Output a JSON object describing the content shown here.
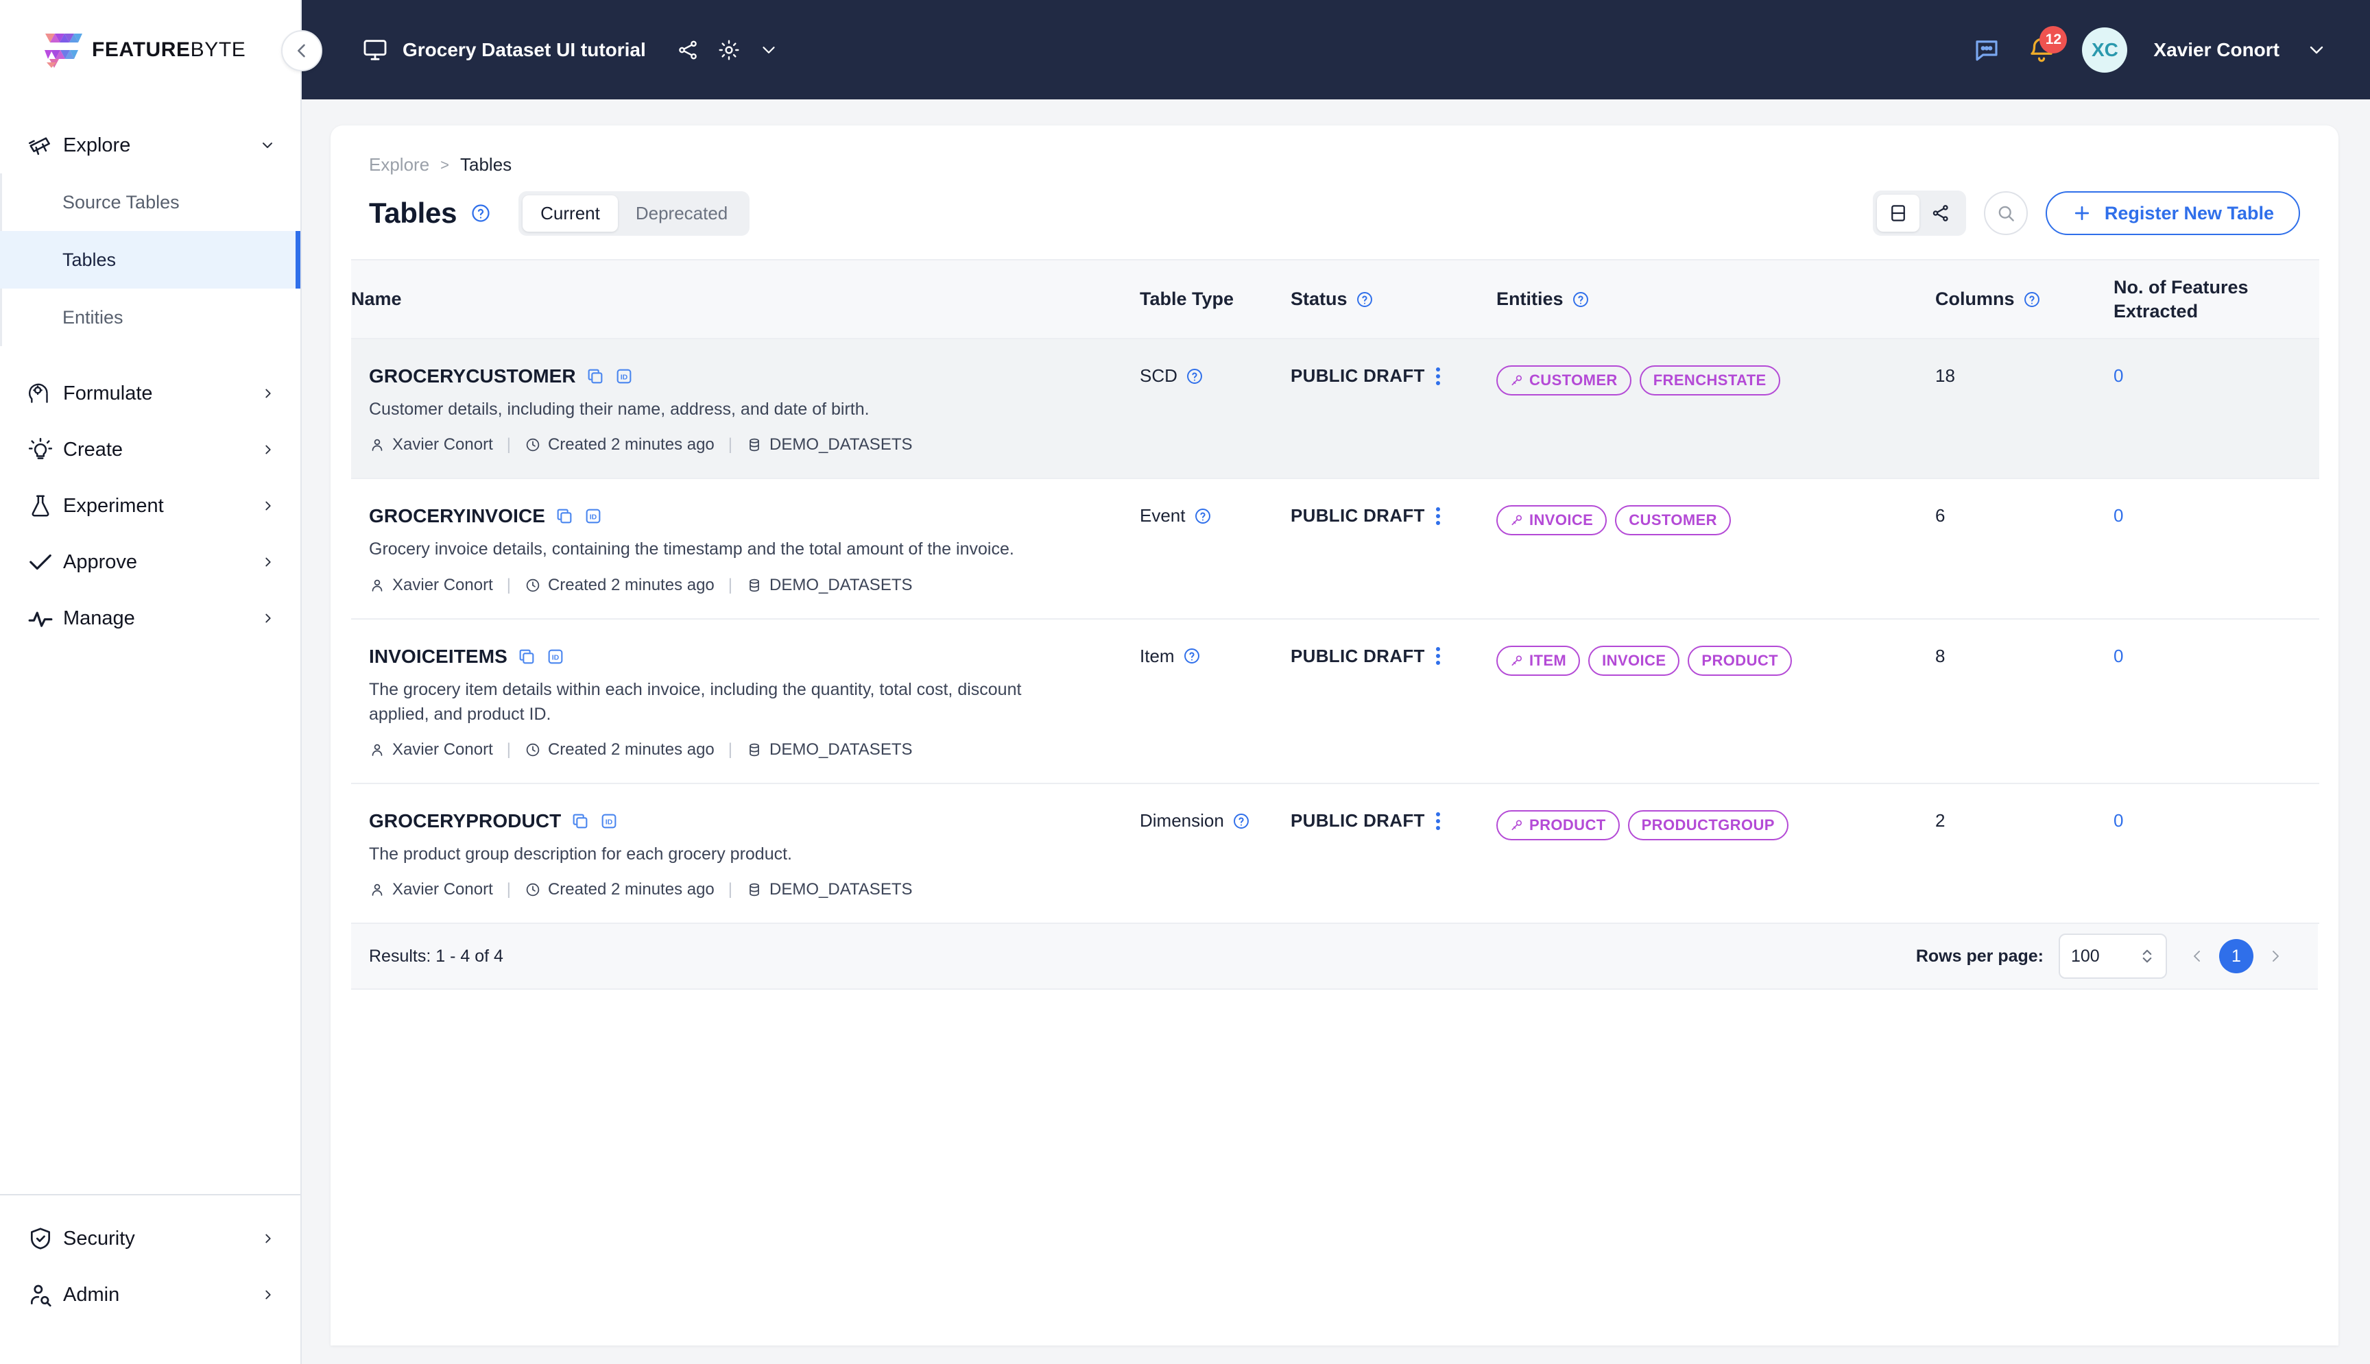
{
  "brand": {
    "name_strong": "FEATURE",
    "name_light": "BYTE",
    "accent_blue": "#2f6fea",
    "accent_purple": "#b44ad6",
    "topbar_bg": "#212a44"
  },
  "topbar": {
    "workspace_title": "Grocery Dataset UI tutorial",
    "share_icon": "share-icon",
    "settings_icon": "gear-icon",
    "dropdown_icon": "chevron-down-icon",
    "chat_icon": "chat-icon",
    "bell_icon": "bell-icon",
    "notification_count": "12",
    "avatar_initials": "XC",
    "user_name": "Xavier Conort",
    "user_menu_icon": "chevron-down-icon",
    "collapse_icon": "chevron-left-icon",
    "monitor_icon": "monitor-icon"
  },
  "sidebar": {
    "groups": [
      {
        "label": "Explore",
        "icon": "telescope-icon",
        "expanded": true,
        "chevron": "chevron-down-icon",
        "children": [
          {
            "label": "Source Tables",
            "active": false
          },
          {
            "label": "Tables",
            "active": true
          },
          {
            "label": "Entities",
            "active": false
          }
        ]
      },
      {
        "label": "Formulate",
        "icon": "head-gear-icon",
        "expanded": false,
        "chevron": "chevron-right-icon",
        "children": []
      },
      {
        "label": "Create",
        "icon": "lightbulb-icon",
        "expanded": false,
        "chevron": "chevron-right-icon",
        "children": []
      },
      {
        "label": "Experiment",
        "icon": "flask-icon",
        "expanded": false,
        "chevron": "chevron-right-icon",
        "children": []
      },
      {
        "label": "Approve",
        "icon": "check-icon",
        "expanded": false,
        "chevron": "chevron-right-icon",
        "children": []
      },
      {
        "label": "Manage",
        "icon": "pulse-icon",
        "expanded": false,
        "chevron": "chevron-right-icon",
        "children": []
      }
    ],
    "bottom_groups": [
      {
        "label": "Security",
        "icon": "shield-check-icon",
        "chevron": "chevron-right-icon"
      },
      {
        "label": "Admin",
        "icon": "user-search-icon",
        "chevron": "chevron-right-icon"
      }
    ]
  },
  "page": {
    "breadcrumb": {
      "parent": "Explore",
      "separator": ">",
      "current": "Tables"
    },
    "title": "Tables",
    "title_help_icon": "help-circle-icon",
    "tabs": [
      {
        "label": "Current",
        "active": true
      },
      {
        "label": "Deprecated",
        "active": false
      }
    ],
    "view_toggle": [
      {
        "icon": "table-view-icon",
        "active": true
      },
      {
        "icon": "graph-view-icon",
        "active": false
      }
    ],
    "search_icon": "search-icon",
    "register_button": {
      "label": "Register New Table",
      "icon": "plus-icon"
    }
  },
  "table": {
    "columns": [
      {
        "key": "name",
        "label": "Name",
        "help": false
      },
      {
        "key": "table_type",
        "label": "Table Type",
        "help": false
      },
      {
        "key": "status",
        "label": "Status",
        "help": true
      },
      {
        "key": "entities",
        "label": "Entities",
        "help": true
      },
      {
        "key": "columns",
        "label": "Columns",
        "help": true
      },
      {
        "key": "features",
        "label": "No. of Features\nExtracted",
        "label_line1": "No. of Features",
        "label_line2": "Extracted",
        "help": false
      }
    ],
    "rows": [
      {
        "name": "GROCERYCUSTOMER",
        "copy_icon": "copy-icon",
        "id_icon": "id-badge-icon",
        "description": "Customer details, including their name, address, and date of birth.",
        "author": "Xavier Conort",
        "created": "Created 2 minutes ago",
        "source": "DEMO_DATASETS",
        "table_type": "SCD",
        "type_help_icon": "help-circle-icon",
        "status": "PUBLIC DRAFT",
        "kebab_icon": "more-vertical-icon",
        "entities": [
          {
            "label": "CUSTOMER",
            "primary": true
          },
          {
            "label": "FRENCHSTATE",
            "primary": false
          }
        ],
        "columns": "18",
        "features": "0",
        "highlighted": true
      },
      {
        "name": "GROCERYINVOICE",
        "copy_icon": "copy-icon",
        "id_icon": "id-badge-icon",
        "description": "Grocery invoice details, containing the timestamp and the total amount of the invoice.",
        "author": "Xavier Conort",
        "created": "Created 2 minutes ago",
        "source": "DEMO_DATASETS",
        "table_type": "Event",
        "type_help_icon": "help-circle-icon",
        "status": "PUBLIC DRAFT",
        "kebab_icon": "more-vertical-icon",
        "entities": [
          {
            "label": "INVOICE",
            "primary": true
          },
          {
            "label": "CUSTOMER",
            "primary": false
          }
        ],
        "columns": "6",
        "features": "0",
        "highlighted": false
      },
      {
        "name": "INVOICEITEMS",
        "copy_icon": "copy-icon",
        "id_icon": "id-badge-icon",
        "description": "The grocery item details within each invoice, including the quantity, total cost, discount applied, and product ID.",
        "author": "Xavier Conort",
        "created": "Created 2 minutes ago",
        "source": "DEMO_DATASETS",
        "table_type": "Item",
        "type_help_icon": "help-circle-icon",
        "status": "PUBLIC DRAFT",
        "kebab_icon": "more-vertical-icon",
        "entities": [
          {
            "label": "ITEM",
            "primary": true
          },
          {
            "label": "INVOICE",
            "primary": false
          },
          {
            "label": "PRODUCT",
            "primary": false
          }
        ],
        "columns": "8",
        "features": "0",
        "highlighted": false
      },
      {
        "name": "GROCERYPRODUCT",
        "copy_icon": "copy-icon",
        "id_icon": "id-badge-icon",
        "description": "The product group description for each grocery product.",
        "author": "Xavier Conort",
        "created": "Created 2 minutes ago",
        "source": "DEMO_DATASETS",
        "table_type": "Dimension",
        "type_help_icon": "help-circle-icon",
        "status": "PUBLIC DRAFT",
        "kebab_icon": "more-vertical-icon",
        "entities": [
          {
            "label": "PRODUCT",
            "primary": true
          },
          {
            "label": "PRODUCTGROUP",
            "primary": false
          }
        ],
        "columns": "2",
        "features": "0",
        "highlighted": false
      }
    ]
  },
  "footer": {
    "results": "Results: 1 - 4 of 4",
    "rows_per_page_label": "Rows per page:",
    "rows_per_page_value": "100",
    "prev_icon": "chevron-left-icon",
    "next_icon": "chevron-right-icon",
    "current_page": "1"
  }
}
